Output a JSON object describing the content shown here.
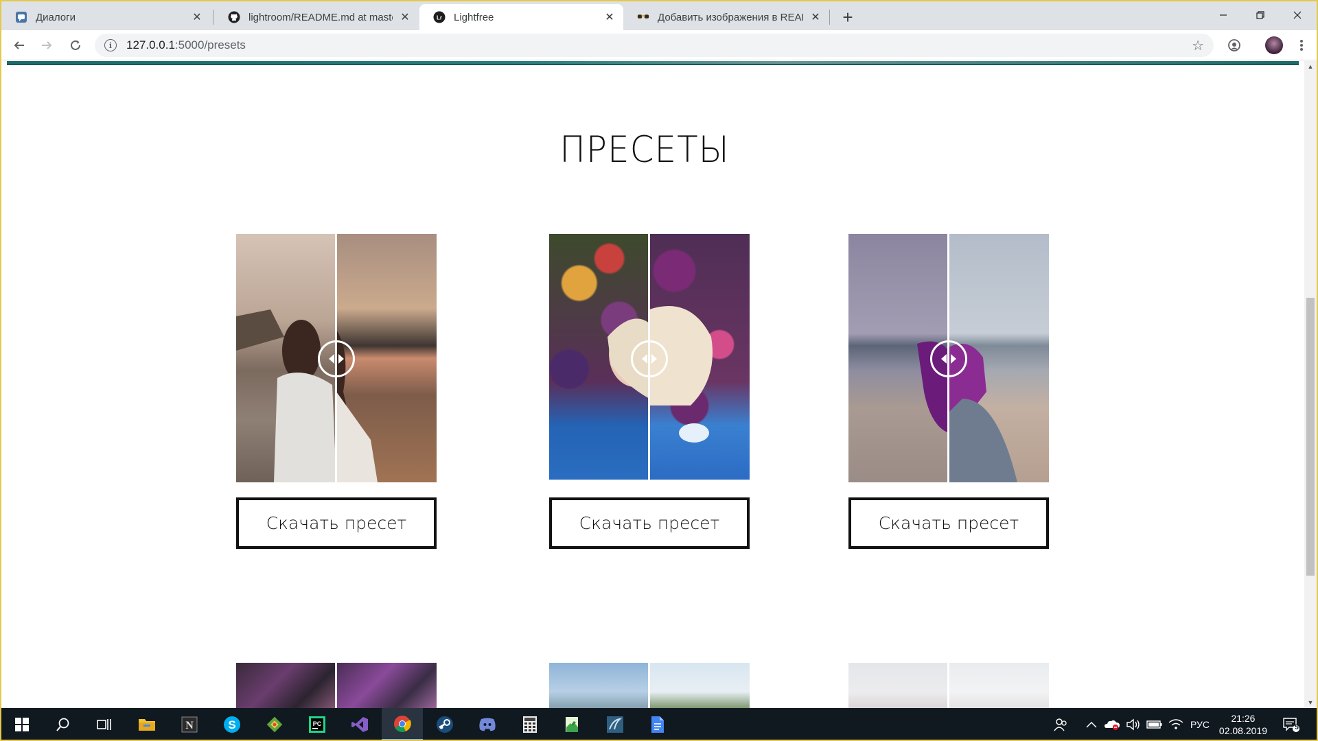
{
  "browser": {
    "tabs": [
      {
        "title": "Диалоги",
        "icon": "vk-icon"
      },
      {
        "title": "lightroom/README.md at master",
        "icon": "github-icon"
      },
      {
        "title": "Lightfree",
        "icon": "lightroom-icon",
        "active": true
      },
      {
        "title": "Добавить изображения в READM",
        "icon": "sunglasses-icon"
      }
    ],
    "address": {
      "host": "127.0.0.1",
      "path": ":5000/presets"
    }
  },
  "page": {
    "heading": "ПРЕСЕТЫ",
    "download_label": "Скачать пресет",
    "presets": [
      {
        "name": "preset-1",
        "left_colors": [
          "#b79d8c",
          "#6f5d52",
          "#8c7a6a"
        ],
        "right_colors": [
          "#b07a5c",
          "#4a3a33",
          "#a57354"
        ]
      },
      {
        "name": "preset-2",
        "left_colors": [
          "#5b2a5e",
          "#d9a441",
          "#2f63b0"
        ],
        "right_colors": [
          "#7a2d73",
          "#e7d6b2",
          "#3c79c8"
        ]
      },
      {
        "name": "preset-3",
        "left_colors": [
          "#8c8aa1",
          "#6c7083",
          "#9b8f8d"
        ],
        "right_colors": [
          "#aab4c4",
          "#7e8594",
          "#b09a8a"
        ]
      }
    ]
  },
  "taskbar": {
    "apps": [
      "windows-start-icon",
      "search-icon",
      "task-view-icon",
      "file-explorer-icon",
      "notion-icon",
      "skype-icon",
      "git-icon",
      "pycharm-icon",
      "visual-studio-icon",
      "chrome-icon",
      "steam-icon",
      "discord-icon",
      "calculator-icon",
      "notepad-icon",
      "mysql-workbench-icon",
      "docs-icon"
    ],
    "language": "РУС",
    "time": "21:26",
    "date": "02.08.2019",
    "notifications": "5"
  },
  "colors": {
    "accent": "#1f6b6a",
    "taskbar": "#101820",
    "window_border": "#e6c84a"
  }
}
